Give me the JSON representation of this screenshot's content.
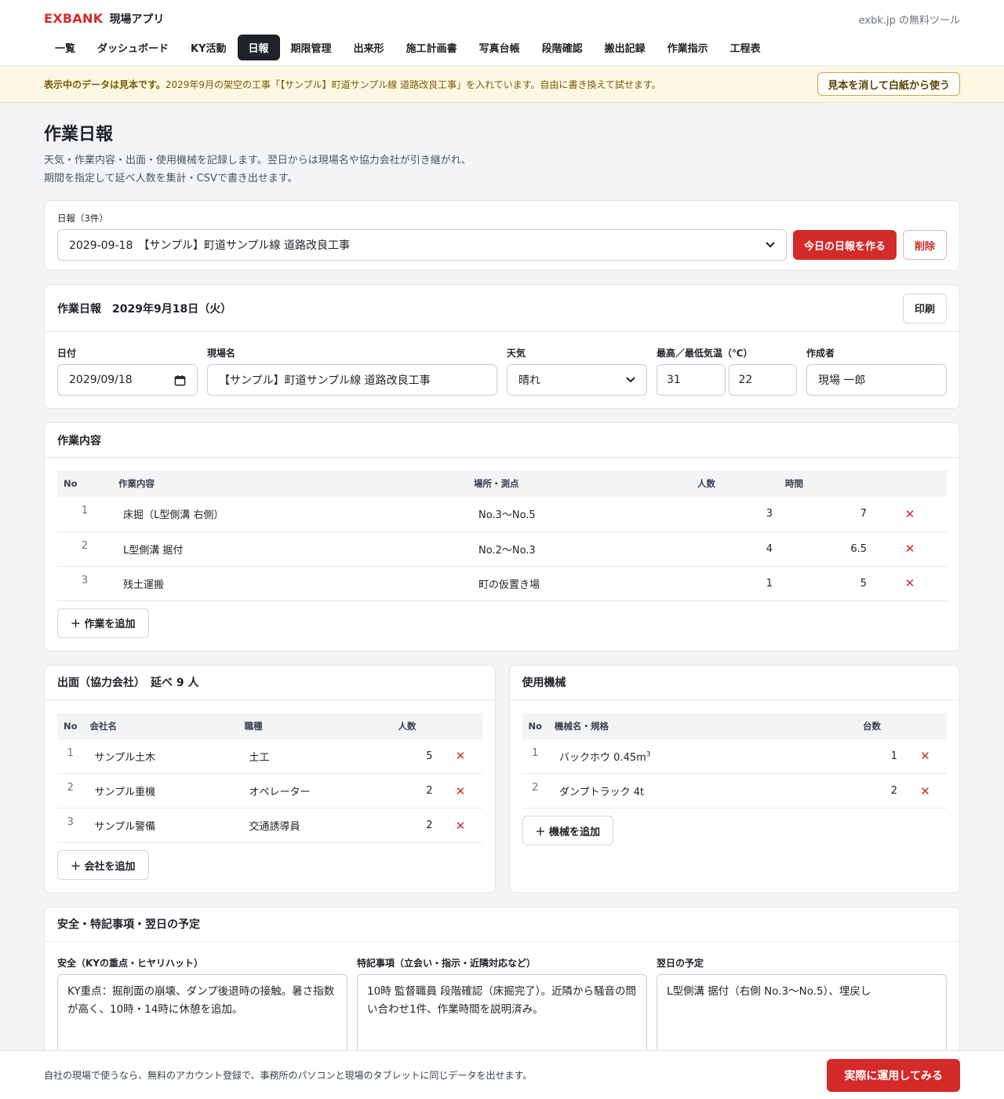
{
  "header": {
    "logo": "EXBANK",
    "app_name": "現場アプリ",
    "free_tool": "exbk.jp の無料ツール",
    "nav": [
      "一覧",
      "ダッシュボード",
      "KY活動",
      "日報",
      "期限管理",
      "出来形",
      "施工計画書",
      "写真台帳",
      "段階確認",
      "搬出記録",
      "作業指示",
      "工程表"
    ],
    "active_nav": "日報"
  },
  "banner": {
    "strong": "表示中のデータは見本です。",
    "text": "2029年9月の架空の工事「【サンプル】町道サンプル線 道路改良工事」を入れています。自由に書き換えて試せます。",
    "button": "見本を消して白紙から使う"
  },
  "page": {
    "title": "作業日報",
    "desc_1": "天気・作業内容・出面・使用機械を記録します。翌日からは現場名や協力会社が引き継がれ、",
    "desc_2": "期間を指定して延べ人数を集計・CSVで書き出せます。"
  },
  "report_select": {
    "label": "日報（3件）",
    "value": "2029-09-18　【サンプル】町道サンプル線 道路改良工事",
    "create_button": "今日の日報を作る",
    "delete_button": "削除"
  },
  "report": {
    "title": "作業日報　2029年9月18日（火）",
    "print_button": "印刷",
    "date_label": "日付",
    "date_value": "2029/09/18",
    "site_label": "現場名",
    "site_value": "【サンプル】町道サンプル線 道路改良工事",
    "weather_label": "天気",
    "weather_value": "晴れ",
    "temp_label": "最高／最低気温（℃）",
    "temp_high": "31",
    "temp_low": "22",
    "author_label": "作成者",
    "author_value": "現場 一郎"
  },
  "work": {
    "title": "作業内容",
    "headers": [
      "No",
      "作業内容",
      "場所・測点",
      "人数",
      "時間"
    ],
    "rows": [
      {
        "no": "1",
        "content": "床掘（L型側溝 右側）",
        "place": "No.3〜No.5",
        "people": "3",
        "hours": "7"
      },
      {
        "no": "2",
        "content": "L型側溝 据付",
        "place": "No.2〜No.3",
        "people": "4",
        "hours": "6.5"
      },
      {
        "no": "3",
        "content": "残土運搬",
        "place": "町の仮置き場",
        "people": "1",
        "hours": "5"
      }
    ],
    "add_button": "＋ 作業を追加"
  },
  "attendance": {
    "title": "出面（協力会社）　延べ 9 人",
    "headers": [
      "No",
      "会社名",
      "職種",
      "人数"
    ],
    "rows": [
      {
        "no": "1",
        "company": "サンプル土木",
        "trade": "土工",
        "people": "5"
      },
      {
        "no": "2",
        "company": "サンプル重機",
        "trade": "オペレーター",
        "people": "2"
      },
      {
        "no": "3",
        "company": "サンプル警備",
        "trade": "交通誘導員",
        "people": "2"
      }
    ],
    "add_button": "＋ 会社を追加"
  },
  "machines": {
    "title": "使用機械",
    "headers": [
      "No",
      "機械名・規格",
      "台数"
    ],
    "rows": [
      {
        "no": "1",
        "name": "バックホウ 0.45m",
        "sup": "3",
        "count": "1"
      },
      {
        "no": "2",
        "name": "ダンプトラック 4t",
        "sup": "",
        "count": "2"
      }
    ],
    "add_button": "＋ 機械を追加"
  },
  "notes": {
    "title": "安全・特記事項・翌日の予定",
    "safety_label": "安全（KYの重点・ヒヤリハット）",
    "safety_value": "KY重点：掘削面の崩壊、ダンプ後退時の接触。暑さ指数が高く、10時・14時に休憩を追加。",
    "special_label": "特記事項（立会い・指示・近隣対応など）",
    "special_value": "10時 監督職員 段階確認（床掘完了）。近隣から騒音の問い合わせ1件、作業時間を説明済み。",
    "next_label": "翌日の予定",
    "next_value": "L型側溝 据付（右側 No.3〜No.5）、埋戻し"
  },
  "footer": {
    "text": "自社の現場で使うなら、無料のアカウント登録で、事務所のパソコンと現場のタブレットに同じデータを出せます。",
    "button": "実際に運用してみる"
  },
  "colors": {
    "accent": "#d42a2a",
    "dark": "#1f2328",
    "banner_bg": "#fdf6e3"
  }
}
